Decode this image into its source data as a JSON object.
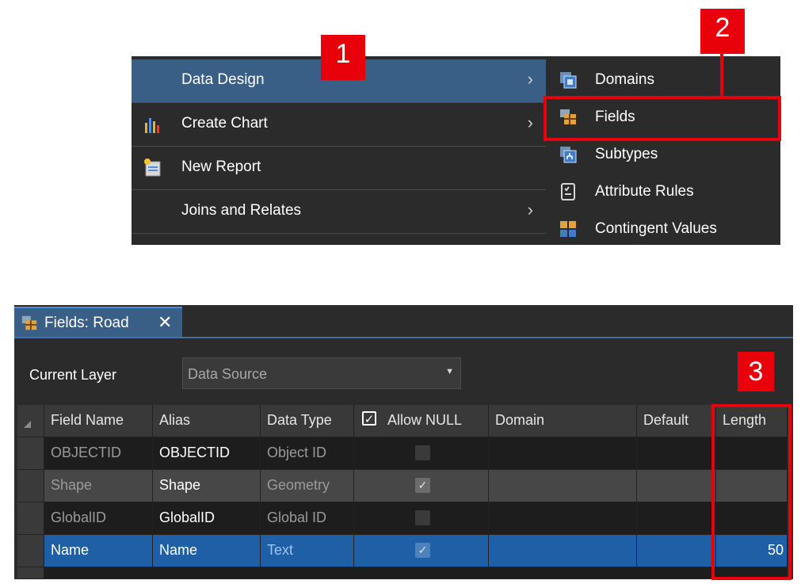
{
  "callouts": [
    "1",
    "2",
    "3"
  ],
  "context_menu": {
    "items": [
      {
        "label": "Data Design",
        "icon": "none",
        "has_submenu": true,
        "highlighted": true
      },
      {
        "label": "Create Chart",
        "icon": "bar-chart-icon",
        "has_submenu": true
      },
      {
        "label": "New Report",
        "icon": "report-icon",
        "has_submenu": false
      },
      {
        "label": "Joins and Relates",
        "icon": "none",
        "has_submenu": true
      }
    ],
    "chevron": "›"
  },
  "submenu": {
    "items": [
      {
        "label": "Domains",
        "icon": "domains-icon"
      },
      {
        "label": "Fields",
        "icon": "fields-icon",
        "highlighted_by_callout": true
      },
      {
        "label": "Subtypes",
        "icon": "subtypes-icon"
      },
      {
        "label": "Attribute Rules",
        "icon": "attribute-rules-icon"
      },
      {
        "label": "Contingent Values",
        "icon": "contingent-values-icon"
      }
    ]
  },
  "fields_view": {
    "tab_label": "Fields: Road",
    "tab_close": "✕",
    "current_layer_label": "Current Layer",
    "data_source_value": "Data Source",
    "columns": [
      "Field Name",
      "Alias",
      "Data Type",
      "Allow NULL",
      "Domain",
      "Default",
      "Length"
    ],
    "rows": [
      {
        "field_name": "OBJECTID",
        "alias": "OBJECTID",
        "data_type": "Object ID",
        "allow_null": false,
        "domain": "",
        "default": "",
        "length": ""
      },
      {
        "field_name": "Shape",
        "alias": "Shape",
        "data_type": "Geometry",
        "allow_null": true,
        "domain": "",
        "default": "",
        "length": ""
      },
      {
        "field_name": "GlobalID",
        "alias": "GlobalID",
        "data_type": "Global ID",
        "allow_null": false,
        "domain": "",
        "default": "",
        "length": ""
      },
      {
        "field_name": "Name",
        "alias": "Name",
        "data_type": "Text",
        "allow_null": true,
        "domain": "",
        "default": "",
        "length": "50",
        "selected": true
      }
    ]
  },
  "colors": {
    "menu_bg": "#2b2b2b",
    "highlight": "#3a5f86",
    "callout": "#e8000b",
    "selected_row": "#1f5fa5"
  }
}
